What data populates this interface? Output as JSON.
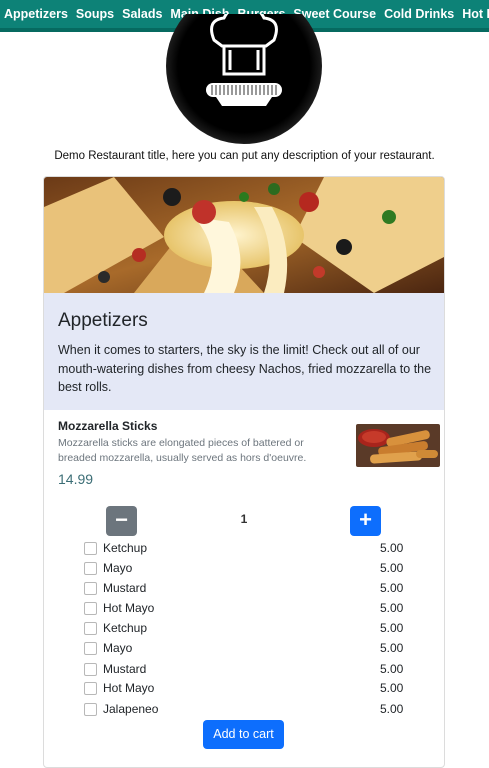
{
  "nav": {
    "items": [
      "Appetizers",
      "Soups",
      "Salads",
      "Main Dish",
      "Burgers",
      "Sweet Course",
      "Cold Drinks",
      "Hot Drinks"
    ]
  },
  "restaurant": {
    "description": "Demo Restaurant title, here you can put any description of your restaurant."
  },
  "category": {
    "title": "Appetizers",
    "description": "When it comes to starters, the sky is the limit! Check out all of our mouth-watering dishes from cheesy Nachos, fried mozzarella to the best rolls."
  },
  "item": {
    "name": "Mozzarella Sticks",
    "description": "Mozzarella sticks are elongated pieces of battered or breaded mozzarella, usually served as hors d'oeuvre.",
    "price": "14.99",
    "quantity": "1",
    "minus_label": "−",
    "plus_label": "+"
  },
  "extras": [
    {
      "label": "Ketchup",
      "price": "5.00"
    },
    {
      "label": "Mayo",
      "price": "5.00"
    },
    {
      "label": "Mustard",
      "price": "5.00"
    },
    {
      "label": "Hot Mayo",
      "price": "5.00"
    },
    {
      "label": "Ketchup",
      "price": "5.00"
    },
    {
      "label": "Mayo",
      "price": "5.00"
    },
    {
      "label": "Mustard",
      "price": "5.00"
    },
    {
      "label": "Hot Mayo",
      "price": "5.00"
    },
    {
      "label": "Jalapeneo",
      "price": "5.00"
    }
  ],
  "cart": {
    "add_label": "Add to cart"
  },
  "colors": {
    "nav": "#0d8277",
    "primary": "#0d6efd",
    "secondary": "#6c757d",
    "category_bg": "#e4e8f6",
    "price": "#3c6e76"
  }
}
